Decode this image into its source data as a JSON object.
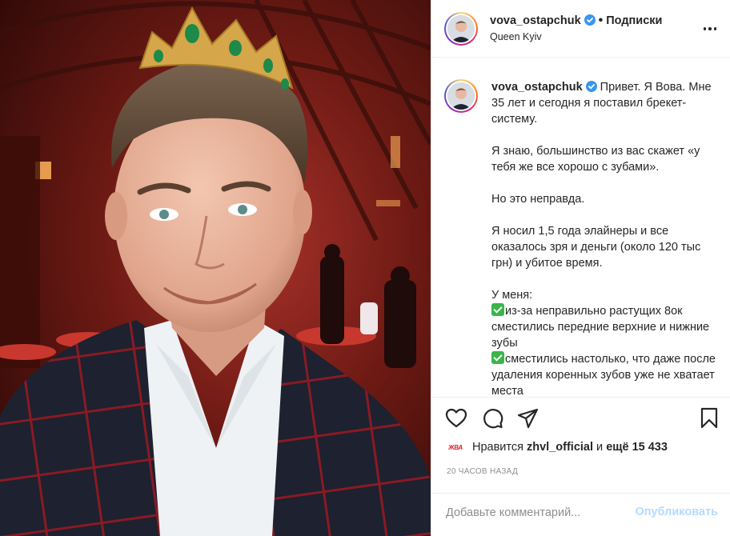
{
  "post": {
    "author": {
      "username": "vova_ostapchuk",
      "verified": true,
      "location": "Queen Kyiv",
      "follow_label": "Подписки",
      "separator": "•"
    },
    "caption": {
      "username": "vova_ostapchuk",
      "paragraphs": [
        "Привет. Я Вова. Мне 35 лет и сегодня я поставил брекет-систему.",
        "Я знаю, большинство из вас скажет «у тебя же все хорошо с зубами».",
        "Но это неправда.",
        "Я носил 1,5 года элайнеры и все оказалось зря и деньги (около 120 тыс грн) и убитое время."
      ],
      "list_title": "У меня:",
      "list_items": [
        "из-за неправильно растущих 8ок сместились передние верхние и нижние зубы",
        "сместились настолько, что даже после удаления коренных зубов уже не хватает места"
      ]
    },
    "actions": {
      "like_icon": "heart-icon",
      "comment_icon": "comment-icon",
      "share_icon": "paper-plane-icon",
      "save_icon": "bookmark-icon"
    },
    "likes": {
      "liker_avatar_text": "ЖВА",
      "prefix": "Нравится",
      "liker": "zhvl_official",
      "and_label": "и",
      "others": "ещё 15 433"
    },
    "time_ago": "20 часов назад",
    "comment": {
      "placeholder": "Добавьте комментарий...",
      "value": "",
      "post_label": "Опубликовать"
    }
  },
  "colors": {
    "text": "#262626",
    "muted": "#8e8e8e",
    "verified": "#3897f0",
    "post_button_disabled": "#b3dbff",
    "check": "#3bb54a",
    "border": "#efefef"
  }
}
